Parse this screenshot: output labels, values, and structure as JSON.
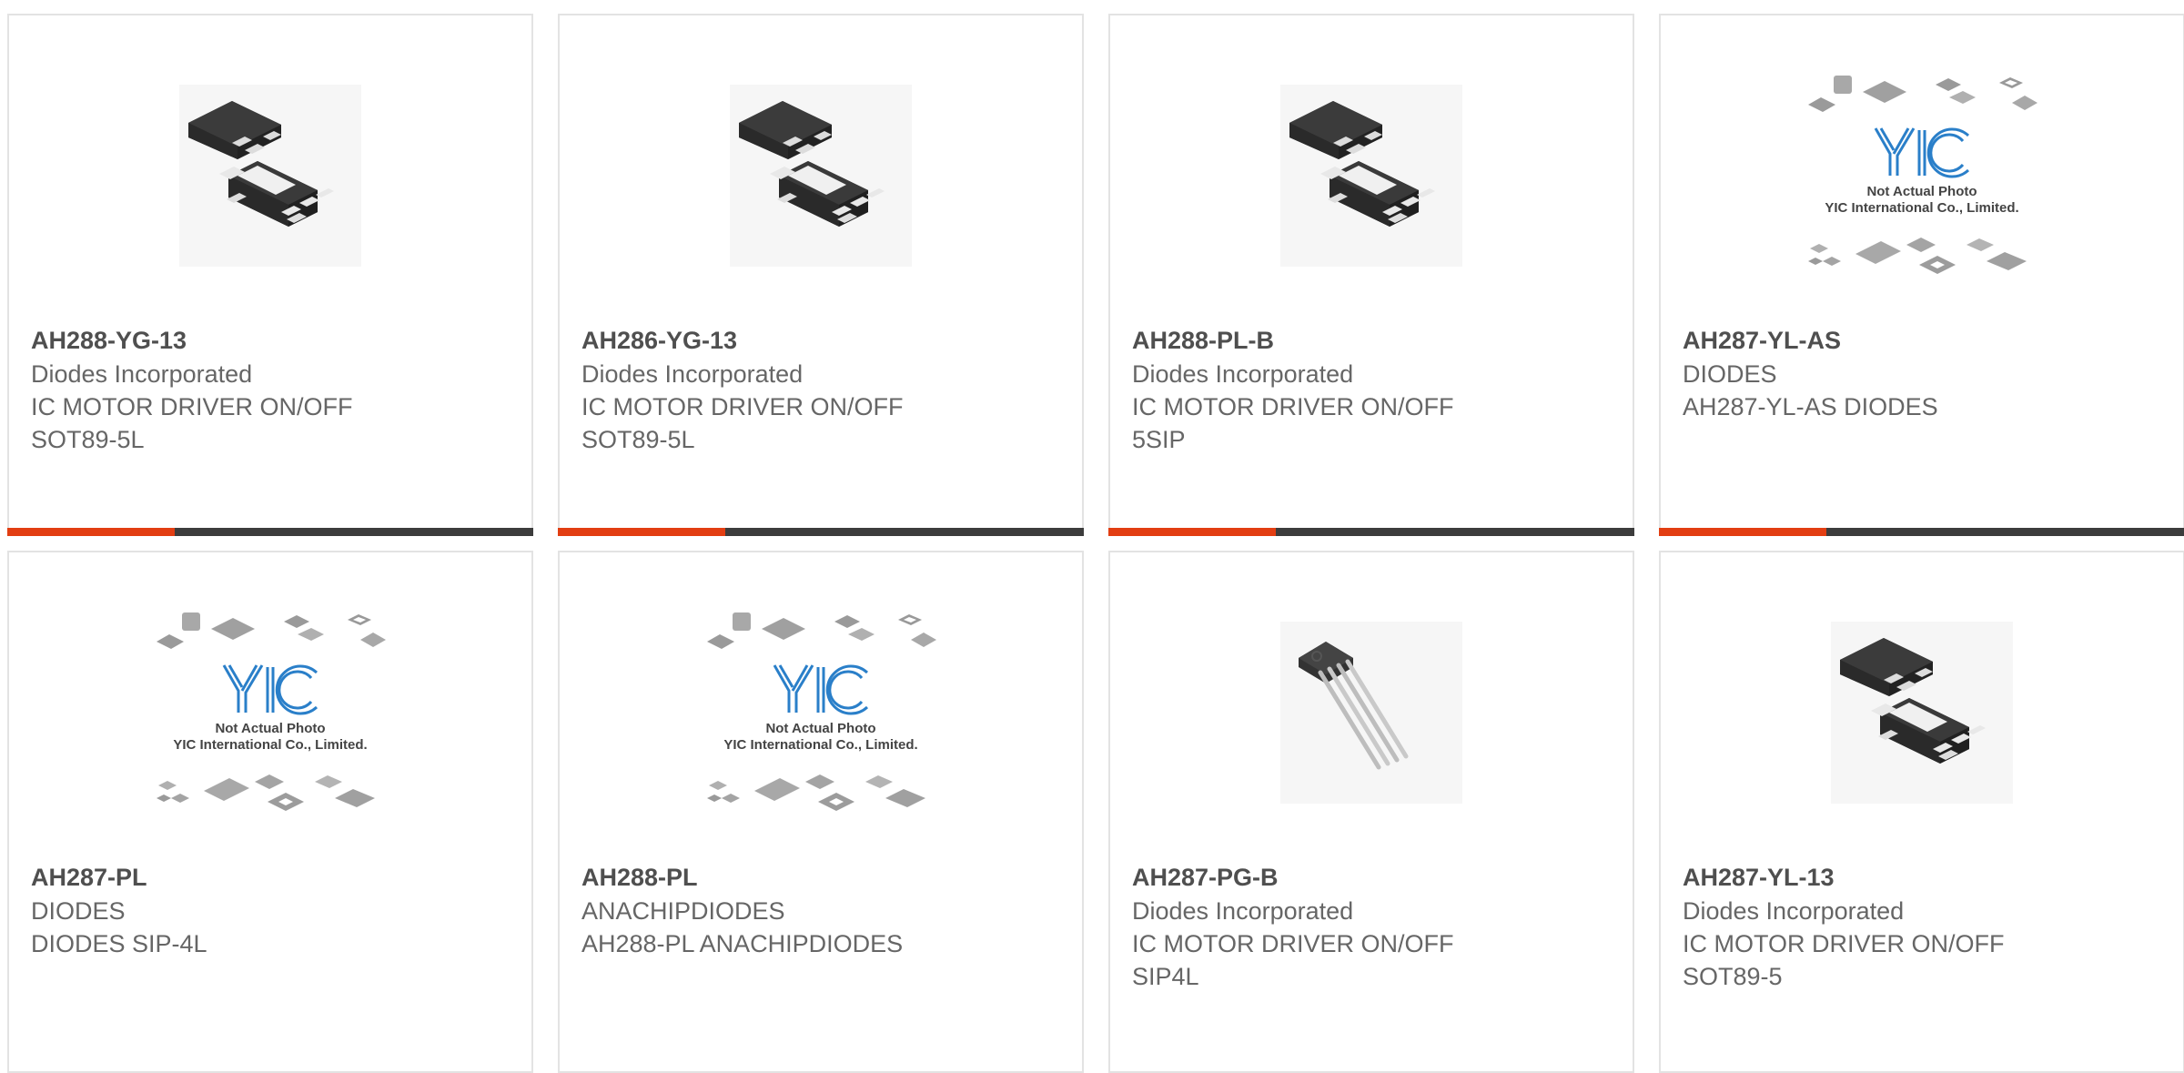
{
  "colors": {
    "accent": "#e23e12",
    "bar_dark": "#3c3c3c",
    "part_number": "#4f4f4f",
    "text": "#666666",
    "border": "#e3e3e3"
  },
  "products": [
    {
      "part_number": "AH288-YG-13",
      "manufacturer": "Diodes Incorporated",
      "description": "IC MOTOR DRIVER ON/OFF",
      "package": "SOT89-5L",
      "image": "sot89-package-image",
      "show_bar": true
    },
    {
      "part_number": "AH286-YG-13",
      "manufacturer": "Diodes Incorporated",
      "description": "IC MOTOR DRIVER ON/OFF",
      "package": "SOT89-5L",
      "image": "sot89-package-image",
      "show_bar": true
    },
    {
      "part_number": "AH288-PL-B",
      "manufacturer": "Diodes Incorporated",
      "description": "IC MOTOR DRIVER ON/OFF",
      "package": "5SIP",
      "image": "sot89-package-image",
      "show_bar": true
    },
    {
      "part_number": "AH287-YL-AS",
      "manufacturer": "DIODES",
      "description": "AH287-YL-AS DIODES",
      "package": "",
      "image": "placeholder-image",
      "show_bar": true
    },
    {
      "part_number": "AH287-PL",
      "manufacturer": "DIODES",
      "description": "DIODES SIP-4L",
      "package": "",
      "image": "placeholder-image",
      "show_bar": false
    },
    {
      "part_number": "AH288-PL",
      "manufacturer": "ANACHIPDIODES",
      "description": "AH288-PL ANACHIPDIODES",
      "package": "",
      "image": "placeholder-image",
      "show_bar": false
    },
    {
      "part_number": "AH287-PG-B",
      "manufacturer": "Diodes Incorporated",
      "description": "IC MOTOR DRIVER ON/OFF",
      "package": "SIP4L",
      "image": "sip4-package-image",
      "show_bar": false
    },
    {
      "part_number": "AH287-YL-13",
      "manufacturer": "Diodes Incorporated",
      "description": "IC MOTOR DRIVER ON/OFF",
      "package": "SOT89-5",
      "image": "sot89-package-image",
      "show_bar": false
    }
  ],
  "placeholder": {
    "logo_text": "YIC",
    "note": "Not Actual Photo",
    "company": "YIC International Co., Limited."
  }
}
